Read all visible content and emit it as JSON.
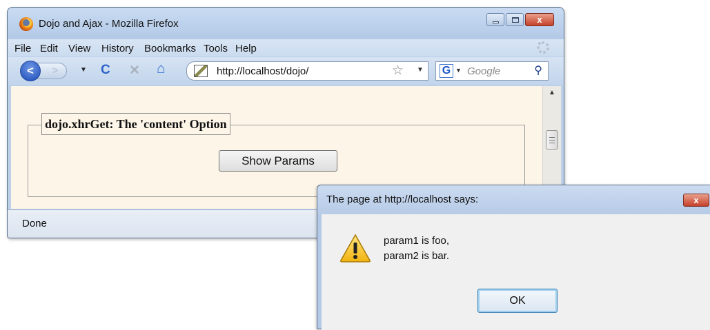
{
  "window": {
    "title": "Dojo and Ajax - Mozilla Firefox",
    "close_glyph": "x"
  },
  "menu": {
    "file": "File",
    "edit": "Edit",
    "view": "View",
    "history": "History",
    "bookmarks": "Bookmarks",
    "tools": "Tools",
    "help": "Help"
  },
  "navbar": {
    "back_glyph": "<",
    "forward_glyph": ">",
    "reload_glyph": "C",
    "stop_glyph": "✕",
    "home_glyph": "⌂",
    "url": "http://localhost/dojo/",
    "star_glyph": "☆",
    "search_engine_glyph": "G",
    "search_placeholder": "Google",
    "search_glyph": "⚲"
  },
  "page": {
    "legend": "dojo.xhrGet: The 'content' Option",
    "button_label": "Show Params"
  },
  "status": {
    "text": "Done"
  },
  "dialog": {
    "title": "The page at http://localhost says:",
    "close_glyph": "x",
    "message_lines": [
      "param1 is foo,",
      "param2 is bar."
    ],
    "ok_label": "OK"
  },
  "colors": {
    "page_background": "#fdf6e8",
    "chrome_blue": "#bcd0ea",
    "close_red": "#c6412a"
  },
  "icons": [
    "firefox-logo-icon",
    "minimize-icon",
    "maximize-icon",
    "close-icon",
    "back-icon",
    "forward-icon",
    "reload-icon",
    "stop-icon",
    "home-icon",
    "site-favicon-icon",
    "bookmark-star-icon",
    "google-icon",
    "search-icon",
    "warning-icon"
  ]
}
